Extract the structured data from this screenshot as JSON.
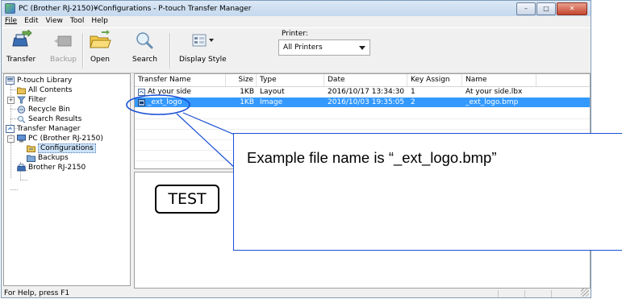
{
  "window": {
    "title": "PC (Brother RJ-2150)¥Configurations - P-touch Transfer Manager",
    "buttons": [
      "–",
      "□",
      "✕"
    ]
  },
  "menu": {
    "items": [
      "File",
      "Edit",
      "View",
      "Tool",
      "Help"
    ]
  },
  "toolbar": {
    "transfer": "Transfer",
    "backup": "Backup",
    "open": "Open",
    "search": "Search",
    "display_style": "Display Style",
    "printer_label": "Printer:",
    "printer_value": "All Printers"
  },
  "tree": {
    "library": "P-touch Library",
    "all_contents": "All Contents",
    "filter": "Filter",
    "recycle_bin": "Recycle Bin",
    "search_results": "Search Results",
    "transfer_manager": "Transfer Manager",
    "pc": "PC (Brother RJ-2150)",
    "configurations": "Configurations",
    "backups": "Backups",
    "printer": "Brother RJ-2150"
  },
  "list": {
    "columns": [
      "Transfer Name",
      "Size",
      "Type",
      "Date",
      "Key Assign",
      "Name"
    ],
    "rows": [
      {
        "transfer_name": "At your side",
        "size": "1KB",
        "type": "Layout",
        "date": "2016/10/17 13:34:30",
        "key": "1",
        "name": "At your side.lbx"
      },
      {
        "transfer_name": "_ext_logo",
        "size": "1KB",
        "type": "Image",
        "date": "2016/10/03 19:35:05",
        "key": "2",
        "name": "_ext_logo.bmp"
      }
    ]
  },
  "preview": {
    "label_text": "TEST"
  },
  "status": {
    "text": "For Help, press F1"
  },
  "callout": {
    "text": "Example file name is “_ext_logo.bmp”",
    "color": "#1a4fd6"
  },
  "colors": {
    "selection": "#3399ff",
    "title_bar": "#c4d8ee"
  }
}
